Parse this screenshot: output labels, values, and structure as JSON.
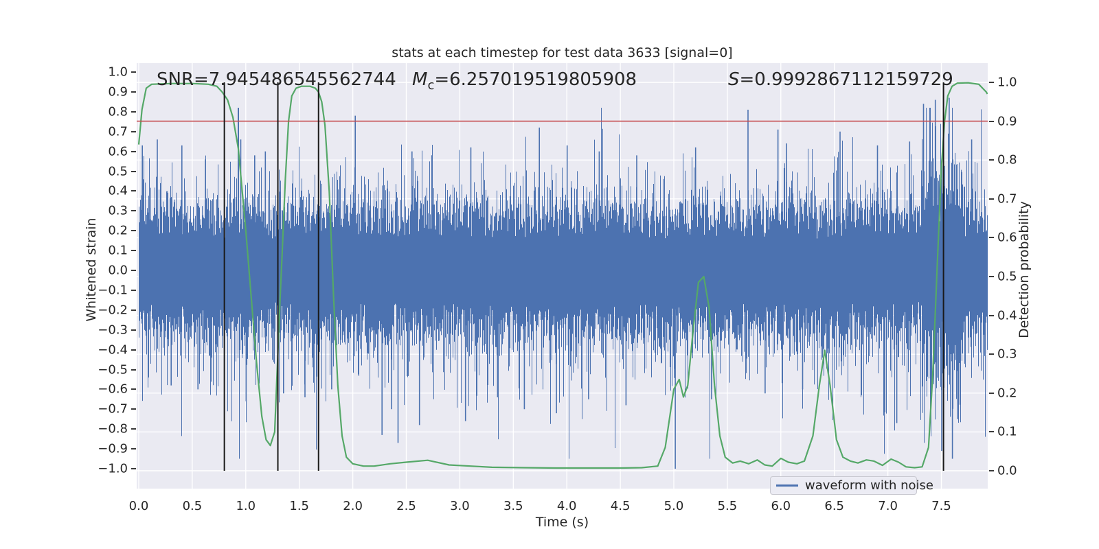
{
  "figure": {
    "title": "stats at each timestep for test data 3633 [signal=0]",
    "xlabel": "Time (s)",
    "ylabel_left": "Whitened strain",
    "ylabel_right": "Detection probability"
  },
  "annotations": {
    "snr": "SNR=7.945486545562744",
    "mc_prefix": "M",
    "mc_sub": "c",
    "mc_value": "=6.257019519805908",
    "s_prefix": "S",
    "s_value": "=0.9992867112159729"
  },
  "legend": {
    "waveform_label": "waveform with noise"
  },
  "colors": {
    "waveform_blue": "#4c72b0",
    "probability_green": "#55a868",
    "threshold_red": "#c44e52",
    "marker_black": "#1a1a1a",
    "axes_background": "#eaeaf2",
    "grid": "#ffffff",
    "text": "#262626"
  },
  "chart_data": {
    "type": "line",
    "title": "stats at each timestep for test data 3633 [signal=0]",
    "xlabel": "Time (s)",
    "ylabel_left": "Whitened strain",
    "ylabel_right": "Detection probability",
    "x_range": [
      0.0,
      7.93
    ],
    "ylim_left": [
      -1.0,
      1.0
    ],
    "ylim_right": [
      0.0,
      1.0
    ],
    "x_ticks": [
      0.0,
      0.5,
      1.0,
      1.5,
      2.0,
      2.5,
      3.0,
      3.5,
      4.0,
      4.5,
      5.0,
      5.5,
      6.0,
      6.5,
      7.0,
      7.5
    ],
    "y_ticks_left": [
      1.0,
      0.9,
      0.8,
      0.7,
      0.6,
      0.5,
      0.4,
      0.3,
      0.2,
      0.1,
      0.0,
      -0.1,
      -0.2,
      -0.3,
      -0.4,
      -0.5,
      -0.6,
      -0.7,
      -0.8,
      -0.9,
      -1.0
    ],
    "y_ticks_right": [
      1.0,
      0.9,
      0.8,
      0.7,
      0.6,
      0.5,
      0.4,
      0.3,
      0.2,
      0.1,
      0.0
    ],
    "grid": true,
    "legend_position": "lower right",
    "threshold_line": {
      "axis": "right",
      "value": 0.9
    },
    "event_marker_times": [
      0.8,
      1.3,
      1.68,
      7.52
    ],
    "series": [
      {
        "name": "waveform with noise",
        "axis": "left",
        "style": "dense gaussian noise band",
        "noise_params": {
          "seed": 42,
          "core_min": 0.155,
          "core_rand_top": 0.15,
          "core_rand_bottom": 0.16,
          "tail_scale_top": 0.095,
          "tail_scale_bottom": 0.118,
          "cap_top": 0.82,
          "cap_bottom": 0.95,
          "boost": {
            "t0": 7.32,
            "t1": 7.7,
            "factor": 1.5
          }
        },
        "feature_spikes_top": [
          [
            0.03,
            0.63
          ],
          [
            0.17,
            0.66
          ],
          [
            0.4,
            0.63
          ],
          [
            0.62,
            0.56
          ],
          [
            0.95,
            0.66
          ],
          [
            1.08,
            0.58
          ],
          [
            1.18,
            0.6
          ],
          [
            2.02,
            0.78
          ],
          [
            2.55,
            0.6
          ],
          [
            3.1,
            0.62
          ],
          [
            3.74,
            0.72
          ],
          [
            4.0,
            0.63
          ],
          [
            4.3,
            0.6
          ],
          [
            4.65,
            0.58
          ],
          [
            5.2,
            0.62
          ],
          [
            5.69,
            0.81
          ],
          [
            5.97,
            0.71
          ],
          [
            6.05,
            0.64
          ],
          [
            6.55,
            0.7
          ],
          [
            6.9,
            0.63
          ],
          [
            7.2,
            0.65
          ],
          [
            7.33,
            0.84
          ],
          [
            7.44,
            0.86
          ],
          [
            7.57,
            0.87
          ],
          [
            7.78,
            0.66
          ]
        ],
        "feature_spikes_bottom": [
          [
            0.3,
            -0.58
          ],
          [
            0.55,
            -0.6
          ],
          [
            1.0,
            -0.66
          ],
          [
            1.35,
            -0.62
          ],
          [
            1.55,
            -0.64
          ],
          [
            1.8,
            -0.6
          ],
          [
            2.27,
            -0.83
          ],
          [
            2.36,
            -0.7
          ],
          [
            2.42,
            -0.87
          ],
          [
            2.62,
            -0.78
          ],
          [
            3.05,
            -0.76
          ],
          [
            3.35,
            -0.64
          ],
          [
            3.6,
            -0.7
          ],
          [
            3.9,
            -0.72
          ],
          [
            4.2,
            -0.65
          ],
          [
            4.55,
            -0.68
          ],
          [
            5.01,
            -1.0
          ],
          [
            5.35,
            -0.65
          ],
          [
            5.85,
            -0.62
          ],
          [
            6.2,
            -0.6
          ],
          [
            6.75,
            -0.63
          ],
          [
            7.08,
            -0.77
          ],
          [
            7.5,
            -0.91
          ],
          [
            7.6,
            -0.95
          ],
          [
            7.65,
            -0.75
          ]
        ]
      },
      {
        "name": "detection probability",
        "axis": "right",
        "points": [
          [
            0.0,
            0.84
          ],
          [
            0.03,
            0.93
          ],
          [
            0.07,
            0.985
          ],
          [
            0.12,
            0.995
          ],
          [
            0.3,
            0.997
          ],
          [
            0.5,
            0.997
          ],
          [
            0.65,
            0.995
          ],
          [
            0.73,
            0.99
          ],
          [
            0.78,
            0.975
          ],
          [
            0.83,
            0.955
          ],
          [
            0.88,
            0.91
          ],
          [
            0.93,
            0.83
          ],
          [
            1.0,
            0.62
          ],
          [
            1.05,
            0.45
          ],
          [
            1.1,
            0.28
          ],
          [
            1.15,
            0.14
          ],
          [
            1.19,
            0.08
          ],
          [
            1.23,
            0.065
          ],
          [
            1.27,
            0.1
          ],
          [
            1.3,
            0.3
          ],
          [
            1.32,
            0.44
          ],
          [
            1.34,
            0.56
          ],
          [
            1.37,
            0.75
          ],
          [
            1.4,
            0.9
          ],
          [
            1.43,
            0.965
          ],
          [
            1.47,
            0.985
          ],
          [
            1.52,
            0.99
          ],
          [
            1.6,
            0.99
          ],
          [
            1.65,
            0.985
          ],
          [
            1.68,
            0.975
          ],
          [
            1.71,
            0.95
          ],
          [
            1.74,
            0.89
          ],
          [
            1.78,
            0.72
          ],
          [
            1.82,
            0.45
          ],
          [
            1.86,
            0.22
          ],
          [
            1.9,
            0.09
          ],
          [
            1.94,
            0.035
          ],
          [
            2.0,
            0.018
          ],
          [
            2.1,
            0.012
          ],
          [
            2.2,
            0.012
          ],
          [
            2.35,
            0.018
          ],
          [
            2.5,
            0.022
          ],
          [
            2.7,
            0.027
          ],
          [
            2.9,
            0.015
          ],
          [
            3.1,
            0.012
          ],
          [
            3.3,
            0.009
          ],
          [
            3.6,
            0.008
          ],
          [
            3.9,
            0.007
          ],
          [
            4.2,
            0.007
          ],
          [
            4.5,
            0.007
          ],
          [
            4.7,
            0.008
          ],
          [
            4.85,
            0.012
          ],
          [
            4.92,
            0.06
          ],
          [
            5.0,
            0.21
          ],
          [
            5.05,
            0.235
          ],
          [
            5.09,
            0.19
          ],
          [
            5.13,
            0.22
          ],
          [
            5.18,
            0.36
          ],
          [
            5.23,
            0.485
          ],
          [
            5.28,
            0.5
          ],
          [
            5.33,
            0.42
          ],
          [
            5.38,
            0.22
          ],
          [
            5.43,
            0.09
          ],
          [
            5.48,
            0.035
          ],
          [
            5.55,
            0.02
          ],
          [
            5.62,
            0.025
          ],
          [
            5.7,
            0.018
          ],
          [
            5.78,
            0.028
          ],
          [
            5.85,
            0.015
          ],
          [
            5.92,
            0.012
          ],
          [
            6.0,
            0.032
          ],
          [
            6.07,
            0.022
          ],
          [
            6.15,
            0.018
          ],
          [
            6.22,
            0.025
          ],
          [
            6.3,
            0.09
          ],
          [
            6.36,
            0.22
          ],
          [
            6.41,
            0.31
          ],
          [
            6.46,
            0.22
          ],
          [
            6.52,
            0.08
          ],
          [
            6.58,
            0.035
          ],
          [
            6.65,
            0.025
          ],
          [
            6.72,
            0.02
          ],
          [
            6.8,
            0.028
          ],
          [
            6.87,
            0.025
          ],
          [
            6.95,
            0.014
          ],
          [
            7.03,
            0.03
          ],
          [
            7.1,
            0.022
          ],
          [
            7.17,
            0.01
          ],
          [
            7.25,
            0.008
          ],
          [
            7.32,
            0.01
          ],
          [
            7.38,
            0.06
          ],
          [
            7.42,
            0.25
          ],
          [
            7.46,
            0.52
          ],
          [
            7.5,
            0.78
          ],
          [
            7.53,
            0.9
          ],
          [
            7.56,
            0.965
          ],
          [
            7.6,
            0.99
          ],
          [
            7.65,
            0.998
          ],
          [
            7.75,
            0.999
          ],
          [
            7.85,
            0.995
          ],
          [
            7.92,
            0.975
          ],
          [
            7.93,
            0.97
          ]
        ]
      }
    ]
  }
}
